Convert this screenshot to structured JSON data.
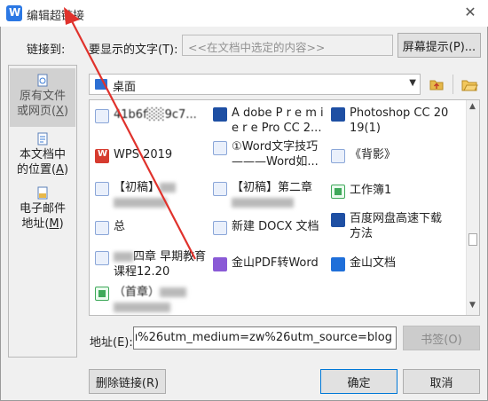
{
  "window": {
    "title": "编辑超链接",
    "close_icon": "close-icon"
  },
  "link_to_label": "链接到:",
  "display_text": {
    "label": "要显示的文字(T):",
    "value": "<<在文档中选定的内容>>"
  },
  "screen_tip_button": "屏幕提示(P)...",
  "nav": {
    "existing": {
      "line1": "原有文件",
      "line2a": "或网页(",
      "key": "X",
      "line2b": ")"
    },
    "location": {
      "line1": "本文档中",
      "line2a": "的位置(",
      "key": "A",
      "line2b": ")"
    },
    "email": {
      "line1": "电子邮件",
      "line2a": "地址(",
      "key": "M",
      "line2b": ")"
    }
  },
  "folder": {
    "current": "桌面"
  },
  "files": [
    {
      "name": "41b6f░░9c7...",
      "icon": "doc-icon"
    },
    {
      "name": "A dobe P r e m i e r e Pro CC 2...",
      "icon": "premiere-icon"
    },
    {
      "name": "Photoshop CC 2019(1)",
      "icon": "premiere-icon"
    },
    {
      "name": "WPS 2019",
      "icon": "wps-app-icon"
    },
    {
      "name": "①Word文字技巧———Word如...",
      "icon": "doc-icon"
    },
    {
      "name": "《背影》",
      "icon": "doc-icon"
    },
    {
      "name": "【初稿】",
      "icon": "doc-icon"
    },
    {
      "name": "【初稿】第二章",
      "icon": "doc-icon"
    },
    {
      "name": "工作簿1",
      "icon": "sheet-icon"
    },
    {
      "name": "总",
      "icon": "doc-icon"
    },
    {
      "name": "新建 DOCX 文档",
      "icon": "doc-icon"
    },
    {
      "name": "百度网盘高速下载方法",
      "icon": "premiere-icon"
    },
    {
      "name": "四章 早期教育课程12.20",
      "icon": "doc-icon"
    },
    {
      "name": "金山PDF转Word",
      "icon": "pdf-icon"
    },
    {
      "name": "金山文档",
      "icon": "wps-doc-icon"
    },
    {
      "name": "（首章）",
      "icon": "sheet-icon"
    }
  ],
  "address": {
    "label": "地址(E):",
    "value": "ı%26utm_medium=zw%26utm_source=blog"
  },
  "bookmark_button": "书签(O)",
  "remove_link_button": "删除链接(R)",
  "ok_button": "确定",
  "cancel_button": "取消"
}
